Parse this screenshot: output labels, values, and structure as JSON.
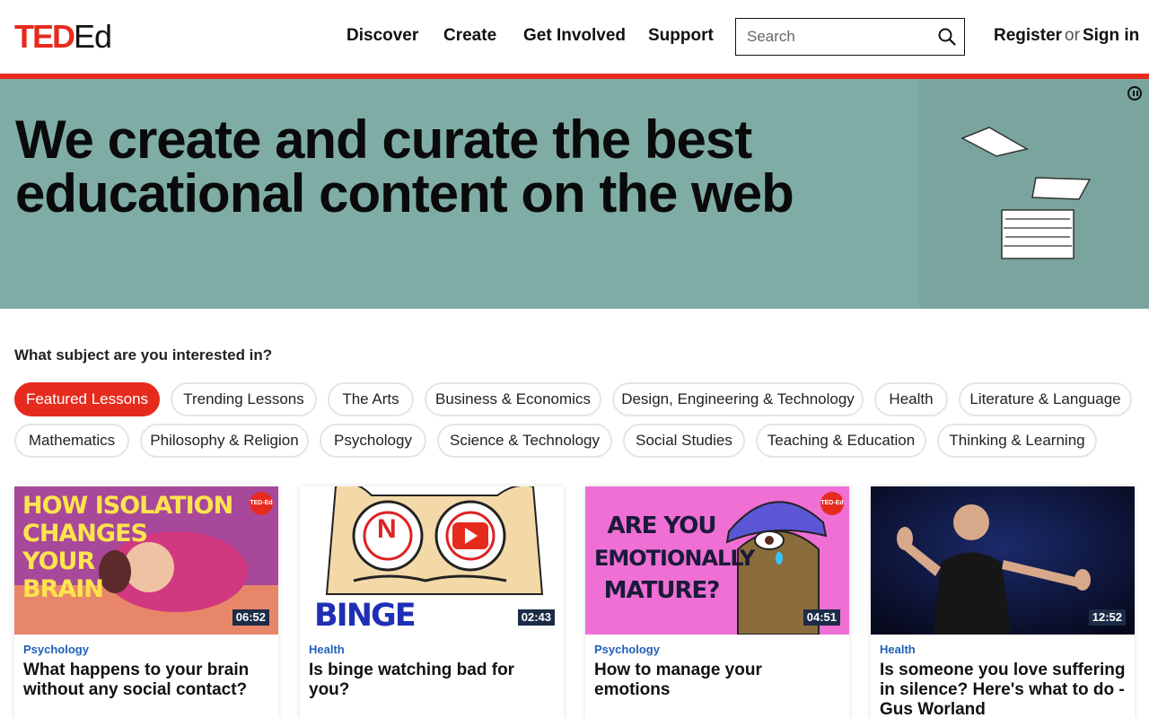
{
  "header": {
    "logo_ted": "TED",
    "logo_ed": "Ed",
    "nav": [
      "Discover",
      "Create",
      "Get Involved",
      "Support"
    ],
    "search_placeholder": "Search",
    "register": "Register",
    "or": "or",
    "sign_in": "Sign in"
  },
  "hero": {
    "headline": "We create and curate the best educational content on the web"
  },
  "subjects": {
    "question": "What subject are you interested in?",
    "pills": [
      "Featured Lessons",
      "Trending Lessons",
      "The Arts",
      "Business & Economics",
      "Design, Engineering & Technology",
      "Health",
      "Literature & Language",
      "Mathematics",
      "Philosophy & Religion",
      "Psychology",
      "Science & Technology",
      "Social Studies",
      "Teaching & Education",
      "Thinking & Learning"
    ],
    "active": "Featured Lessons"
  },
  "cards": [
    {
      "category": "Psychology",
      "title": "What happens to your brain without any social contact?",
      "duration": "06:52",
      "thumb_text": [
        "HOW ISOLATION",
        "CHANGES",
        "YOUR",
        "BRAIN"
      ],
      "badge": "TED-Ed"
    },
    {
      "category": "Health",
      "title": "Is binge watching bad for you?",
      "duration": "02:43",
      "thumb_text": [
        "BINGE WATCHING"
      ],
      "thumb_letter": "N"
    },
    {
      "category": "Psychology",
      "title": "How to manage your emotions",
      "duration": "04:51",
      "thumb_text": [
        "ARE YOU",
        "EMOTIONALLY",
        "MATURE?"
      ],
      "badge": "TED-Ed"
    },
    {
      "category": "Health",
      "title": "Is someone you love suffering in silence? Here's what to do - Gus Worland",
      "duration": "12:52"
    }
  ],
  "colors": {
    "brand_red": "#e62b1e",
    "hero_bg": "#7fada5",
    "category_blue": "#1f5fb8",
    "duration_bg": "#1c2b46"
  },
  "icons": [
    "search-icon",
    "pause-icon"
  ]
}
